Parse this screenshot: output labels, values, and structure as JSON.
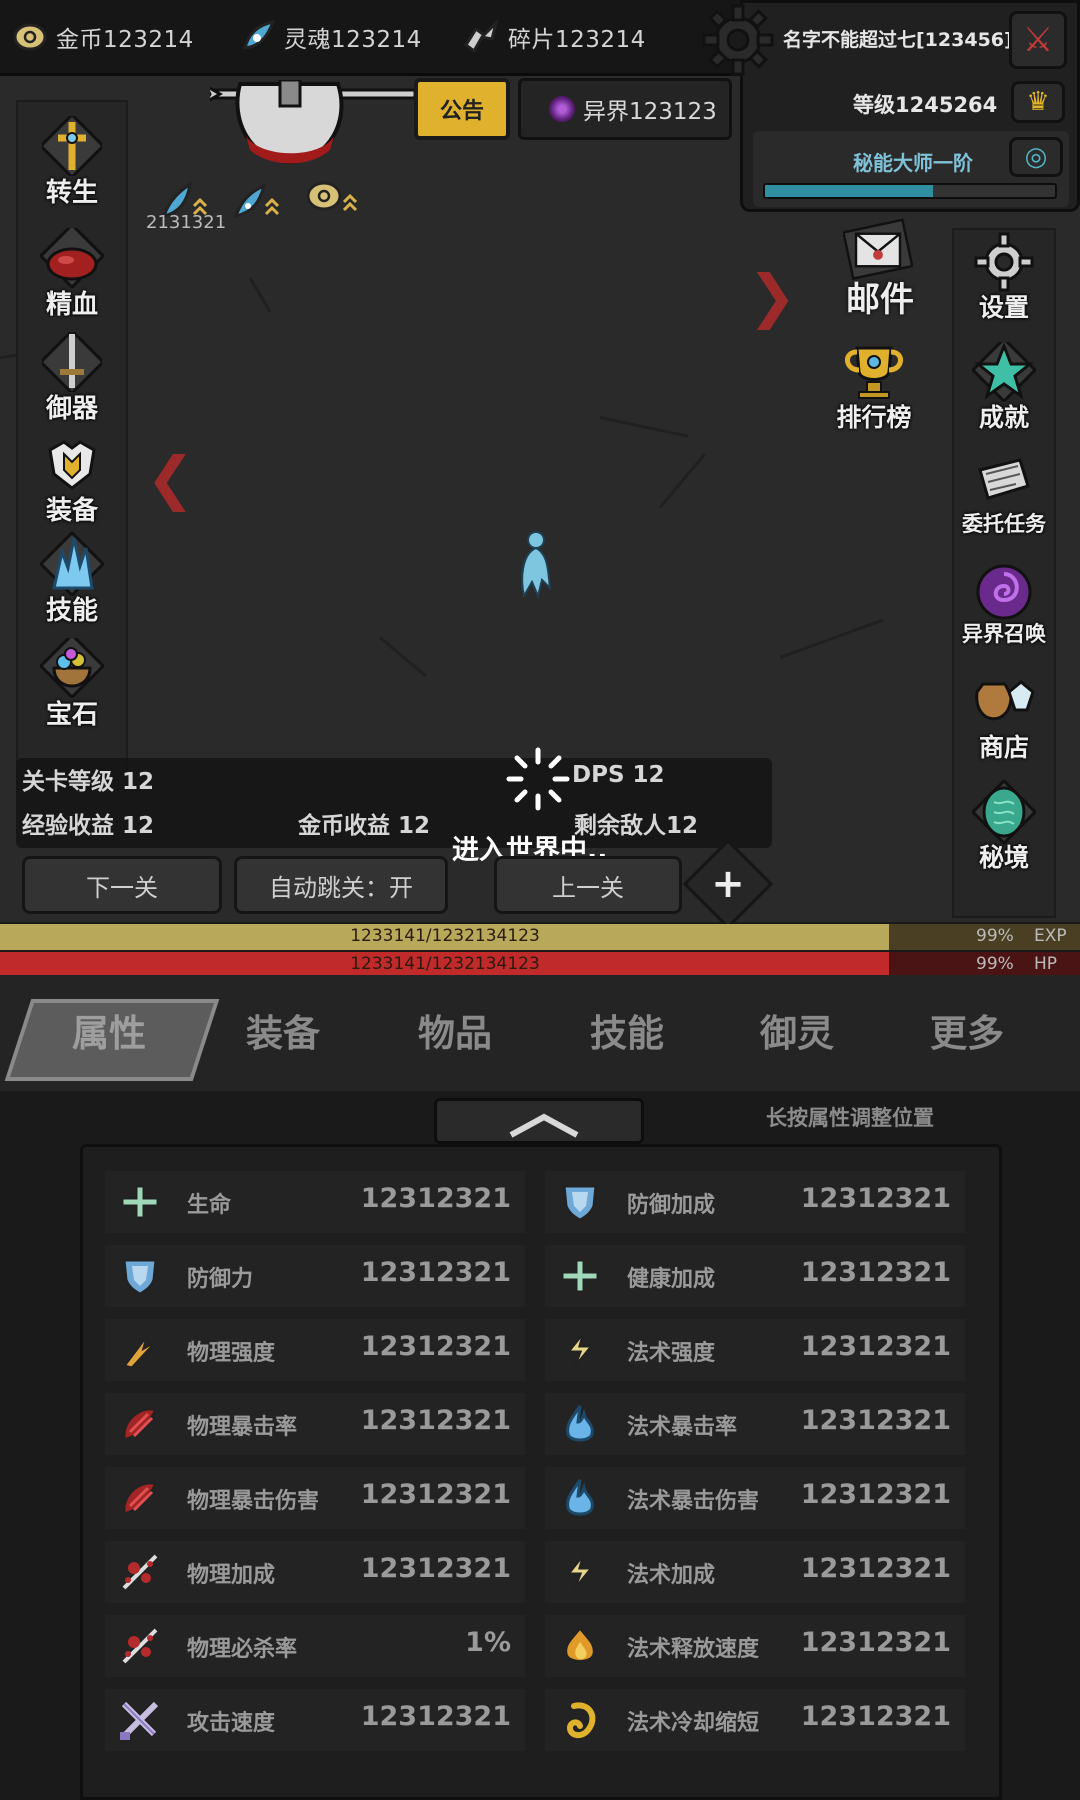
{
  "currencies": [
    {
      "icon": "gold-coin-icon",
      "text": "金币123214"
    },
    {
      "icon": "soul-icon",
      "text": "灵魂123214"
    },
    {
      "icon": "fragment-icon",
      "text": "碎片123214"
    }
  ],
  "player": {
    "name": "名字不能超过七[123456]",
    "level": "等级1245264",
    "title": "秘能大师一阶",
    "title_progress": 0.58
  },
  "field": {
    "notice_label": "公告",
    "otherworld_label": "异界123123",
    "buff_value": "2131321"
  },
  "left_menu": [
    {
      "label": "转生",
      "icon": "cross-icon"
    },
    {
      "label": "精血",
      "icon": "blood-icon"
    },
    {
      "label": "御器",
      "icon": "sword-icon"
    },
    {
      "label": "装备",
      "icon": "armor-icon"
    },
    {
      "label": "技能",
      "icon": "crystal-icon"
    },
    {
      "label": "宝石",
      "icon": "gem-bag-icon"
    }
  ],
  "right_menu": [
    {
      "label": "设置",
      "icon": "gear-icon"
    },
    {
      "label": "成就",
      "icon": "star-icon"
    },
    {
      "label": "委托任务",
      "icon": "scroll-icon"
    },
    {
      "label": "异界召唤",
      "icon": "portal-icon"
    },
    {
      "label": "商店",
      "icon": "shop-bag-icon"
    },
    {
      "label": "秘境",
      "icon": "rune-icon"
    }
  ],
  "inner_menu": [
    {
      "label": "邮件",
      "icon": "mail-icon"
    },
    {
      "label": "排行榜",
      "icon": "trophy-icon"
    }
  ],
  "stage": {
    "level": "关卡等级 12",
    "dps": "DPS 12",
    "exp_income": "经验收益 12",
    "gold_income": "金币收益 12",
    "enemies_left": "剩余敌人12",
    "loading_text": "进入世界中.."
  },
  "stage_buttons": {
    "next": "下一关",
    "auto_skip": "自动跳关：开",
    "prev": "上一关"
  },
  "exp_bar": {
    "text": "1233141/1232134123",
    "percent_text": "99%",
    "label": "EXP",
    "fill": 0.823,
    "color": "#b8a85a"
  },
  "hp_bar": {
    "text": "1233141/1232134123",
    "percent_text": "99%",
    "label": "HP",
    "fill": 0.823,
    "color": "#c02a2a"
  },
  "tabs": [
    "属性",
    "装备",
    "物品",
    "技能",
    "御灵",
    "更多"
  ],
  "active_tab": 0,
  "hint": "长按属性调整位置",
  "attributes_left": [
    {
      "name": "生命",
      "value": "12312321",
      "icon": "health-cross-icon"
    },
    {
      "name": "防御力",
      "value": "12312321",
      "icon": "shield-icon"
    },
    {
      "name": "物理强度",
      "value": "12312321",
      "icon": "claw-icon"
    },
    {
      "name": "物理暴击率",
      "value": "12312321",
      "icon": "red-slash-icon"
    },
    {
      "name": "物理暴击伤害",
      "value": "12312321",
      "icon": "red-slash-icon"
    },
    {
      "name": "物理加成",
      "value": "12312321",
      "icon": "blood-splash-icon"
    },
    {
      "name": "物理必杀率",
      "value": "1%",
      "icon": "blood-splash-icon"
    },
    {
      "name": "攻击速度",
      "value": "12312321",
      "icon": "crossed-swords-icon"
    }
  ],
  "attributes_right": [
    {
      "name": "防御加成",
      "value": "12312321",
      "icon": "shield-icon"
    },
    {
      "name": "健康加成",
      "value": "12312321",
      "icon": "health-cross-icon"
    },
    {
      "name": "法术强度",
      "value": "12312321",
      "icon": "lightning-icon"
    },
    {
      "name": "法术暴击率",
      "value": "12312321",
      "icon": "blue-flame-icon"
    },
    {
      "name": "法术暴击伤害",
      "value": "12312321",
      "icon": "blue-flame-icon"
    },
    {
      "name": "法术加成",
      "value": "12312321",
      "icon": "lightning-icon"
    },
    {
      "name": "法术释放速度",
      "value": "12312321",
      "icon": "fire-icon"
    },
    {
      "name": "法术冷却缩短",
      "value": "12312321",
      "icon": "swirl-icon"
    }
  ]
}
